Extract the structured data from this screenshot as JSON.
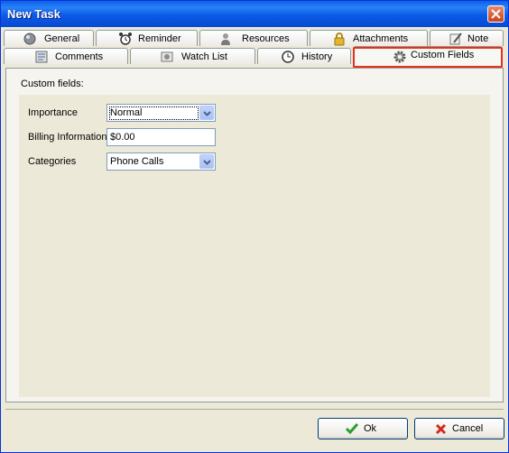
{
  "window": {
    "title": "New Task"
  },
  "tabs": {
    "row1": [
      {
        "label": "General",
        "icon": "general-icon"
      },
      {
        "label": "Reminder",
        "icon": "alarm-clock-icon"
      },
      {
        "label": "Resources",
        "icon": "person-icon"
      },
      {
        "label": "Attachments",
        "icon": "lock-icon"
      },
      {
        "label": "Note",
        "icon": "note-icon"
      }
    ],
    "row2": [
      {
        "label": "Comments",
        "icon": "comments-icon"
      },
      {
        "label": "Watch List",
        "icon": "watch-list-icon"
      },
      {
        "label": "History",
        "icon": "history-icon"
      },
      {
        "label": "Custom Fields",
        "icon": "gear-icon",
        "active": true
      }
    ]
  },
  "custom_fields": {
    "caption": "Custom fields:",
    "importance": {
      "label": "Importance",
      "value": "Normal"
    },
    "billing": {
      "label": "Billing Information",
      "value": "$0.00"
    },
    "categories": {
      "label": "Categories",
      "value": "Phone Calls"
    }
  },
  "buttons": {
    "ok": "Ok",
    "cancel": "Cancel"
  },
  "colors": {
    "title_bar": "#0A5FE9",
    "highlight": "#E8311A",
    "ok_check": "#2E9E2E",
    "cancel_x": "#D42A1E"
  }
}
